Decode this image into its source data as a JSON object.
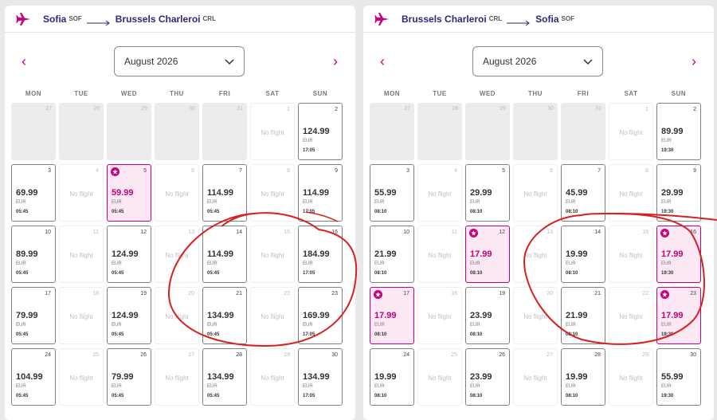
{
  "panels": [
    {
      "origin_city": "Sofia",
      "origin_code": "SOF",
      "dest_city": "Brussels Charleroi",
      "dest_code": "CRL",
      "month": "August 2026",
      "days_of_week": [
        "MON",
        "TUE",
        "WED",
        "THU",
        "FRI",
        "SAT",
        "SUN"
      ],
      "no_flight_label": "No flight",
      "currency": "EUR",
      "cells": [
        {
          "day": "27",
          "state": "disabled"
        },
        {
          "day": "28",
          "state": "disabled"
        },
        {
          "day": "29",
          "state": "disabled"
        },
        {
          "day": "30",
          "state": "disabled"
        },
        {
          "day": "31",
          "state": "disabled"
        },
        {
          "day": "1",
          "state": "noflight"
        },
        {
          "day": "2",
          "state": "priced",
          "price": "124.99",
          "time": "17:05"
        },
        {
          "day": "3",
          "state": "priced",
          "price": "69.99",
          "time": "05:45"
        },
        {
          "day": "4",
          "state": "noflight"
        },
        {
          "day": "5",
          "state": "cheap",
          "price": "59.99",
          "time": "05:45"
        },
        {
          "day": "6",
          "state": "noflight"
        },
        {
          "day": "7",
          "state": "priced",
          "price": "114.99",
          "time": "05:45"
        },
        {
          "day": "8",
          "state": "noflight"
        },
        {
          "day": "9",
          "state": "priced",
          "price": "114.99",
          "time": "17:05"
        },
        {
          "day": "10",
          "state": "priced",
          "price": "89.99",
          "time": "05:45"
        },
        {
          "day": "11",
          "state": "noflight"
        },
        {
          "day": "12",
          "state": "priced",
          "price": "124.99",
          "time": "05:45"
        },
        {
          "day": "13",
          "state": "noflight"
        },
        {
          "day": "14",
          "state": "priced",
          "price": "114.99",
          "time": "05:45"
        },
        {
          "day": "15",
          "state": "noflight"
        },
        {
          "day": "16",
          "state": "priced",
          "price": "184.99",
          "time": "17:05"
        },
        {
          "day": "17",
          "state": "priced",
          "price": "79.99",
          "time": "05:45"
        },
        {
          "day": "18",
          "state": "noflight"
        },
        {
          "day": "19",
          "state": "priced",
          "price": "124.99",
          "time": "05:45"
        },
        {
          "day": "20",
          "state": "noflight"
        },
        {
          "day": "21",
          "state": "priced",
          "price": "134.99",
          "time": "05:45"
        },
        {
          "day": "22",
          "state": "noflight"
        },
        {
          "day": "23",
          "state": "priced",
          "price": "169.99",
          "time": "17:05"
        },
        {
          "day": "24",
          "state": "priced",
          "price": "104.99",
          "time": "05:45"
        },
        {
          "day": "25",
          "state": "noflight"
        },
        {
          "day": "26",
          "state": "priced",
          "price": "79.99",
          "time": "05:45"
        },
        {
          "day": "27",
          "state": "noflight"
        },
        {
          "day": "28",
          "state": "priced",
          "price": "134.99",
          "time": "05:45"
        },
        {
          "day": "29",
          "state": "noflight"
        },
        {
          "day": "30",
          "state": "priced",
          "price": "134.99",
          "time": "17:05"
        }
      ]
    },
    {
      "origin_city": "Brussels Charleroi",
      "origin_code": "CRL",
      "dest_city": "Sofia",
      "dest_code": "SOF",
      "month": "August 2026",
      "days_of_week": [
        "MON",
        "TUE",
        "WED",
        "THU",
        "FRI",
        "SAT",
        "SUN"
      ],
      "no_flight_label": "No flight",
      "currency": "EUR",
      "cells": [
        {
          "day": "27",
          "state": "disabled"
        },
        {
          "day": "28",
          "state": "disabled"
        },
        {
          "day": "29",
          "state": "disabled"
        },
        {
          "day": "30",
          "state": "disabled"
        },
        {
          "day": "31",
          "state": "disabled"
        },
        {
          "day": "1",
          "state": "noflight"
        },
        {
          "day": "2",
          "state": "priced",
          "price": "89.99",
          "time": "19:30"
        },
        {
          "day": "3",
          "state": "priced",
          "price": "55.99",
          "time": "08:10"
        },
        {
          "day": "4",
          "state": "noflight"
        },
        {
          "day": "5",
          "state": "priced",
          "price": "29.99",
          "time": "08:10"
        },
        {
          "day": "6",
          "state": "noflight"
        },
        {
          "day": "7",
          "state": "priced",
          "price": "45.99",
          "time": "08:10"
        },
        {
          "day": "8",
          "state": "noflight"
        },
        {
          "day": "9",
          "state": "priced",
          "price": "29.99",
          "time": "19:30"
        },
        {
          "day": "10",
          "state": "priced",
          "price": "21.99",
          "time": "08:10"
        },
        {
          "day": "11",
          "state": "noflight"
        },
        {
          "day": "12",
          "state": "cheap",
          "price": "17.99",
          "time": "08:10"
        },
        {
          "day": "13",
          "state": "noflight"
        },
        {
          "day": "14",
          "state": "priced",
          "price": "19.99",
          "time": "08:10"
        },
        {
          "day": "15",
          "state": "noflight"
        },
        {
          "day": "16",
          "state": "cheap",
          "price": "17.99",
          "time": "19:30"
        },
        {
          "day": "17",
          "state": "cheap",
          "price": "17.99",
          "time": "08:10"
        },
        {
          "day": "18",
          "state": "noflight"
        },
        {
          "day": "19",
          "state": "priced",
          "price": "23.99",
          "time": "08:10"
        },
        {
          "day": "20",
          "state": "noflight"
        },
        {
          "day": "21",
          "state": "priced",
          "price": "21.99",
          "time": "08:10"
        },
        {
          "day": "22",
          "state": "noflight"
        },
        {
          "day": "23",
          "state": "cheap",
          "price": "17.99",
          "time": "19:30"
        },
        {
          "day": "24",
          "state": "priced",
          "price": "19.99",
          "time": "08:10"
        },
        {
          "day": "25",
          "state": "noflight"
        },
        {
          "day": "26",
          "state": "priced",
          "price": "23.99",
          "time": "08:10"
        },
        {
          "day": "27",
          "state": "noflight"
        },
        {
          "day": "28",
          "state": "priced",
          "price": "19.99",
          "time": "08:10"
        },
        {
          "day": "29",
          "state": "noflight"
        },
        {
          "day": "30",
          "state": "priced",
          "price": "55.99",
          "time": "19:30"
        }
      ]
    }
  ],
  "colors": {
    "brand_pink": "#c6007e",
    "brand_navy": "#2c2a7a",
    "annotation_red": "#d82020"
  }
}
